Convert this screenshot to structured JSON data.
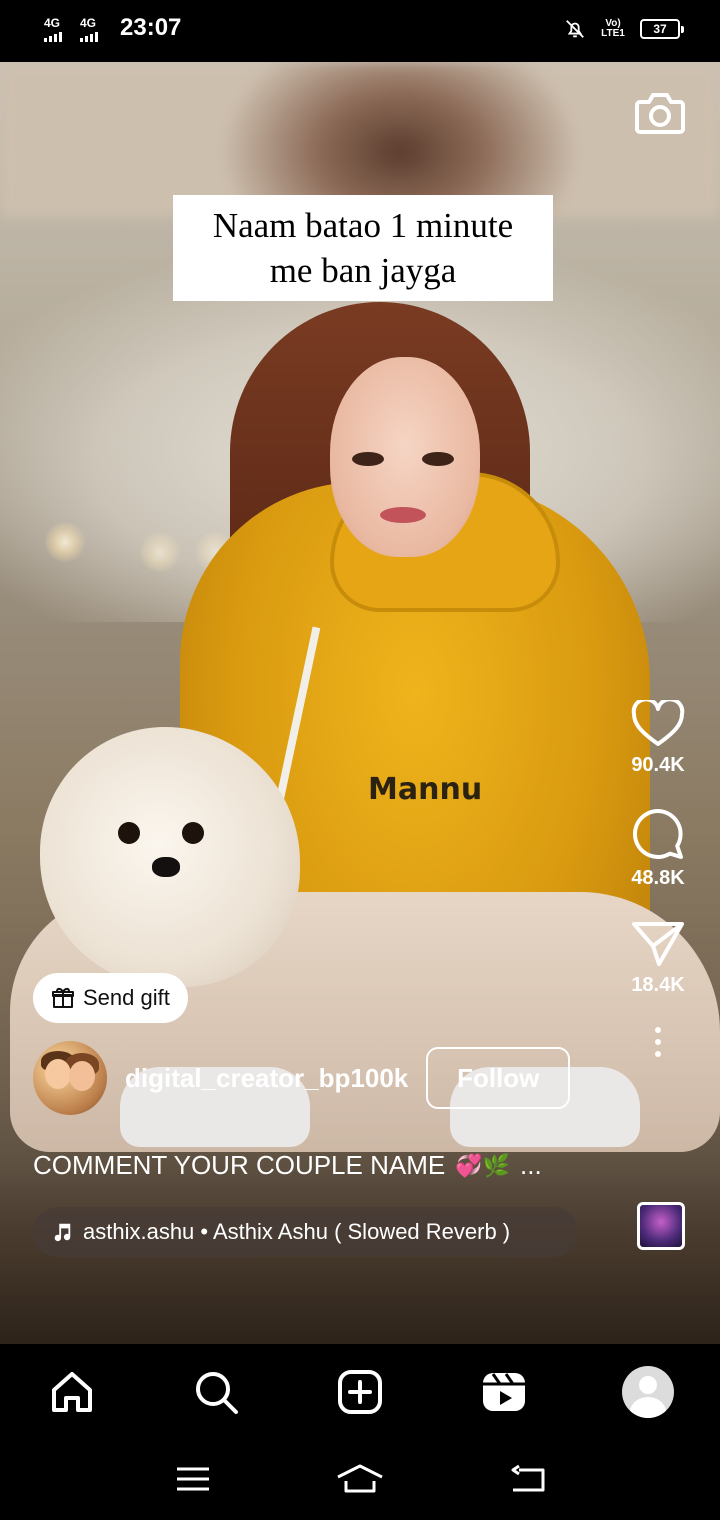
{
  "status_bar": {
    "signal_1_label": "4G",
    "signal_2_label": "4G",
    "time": "23:07",
    "volte_label": "Vo) LTE1",
    "battery_level": "37",
    "icons": [
      "mute-icon",
      "volte-icon",
      "battery-icon"
    ]
  },
  "reel": {
    "caption_line1": "Naam batao 1 minute",
    "caption_line2": "me ban jayga",
    "hoodie_text": "Mannu",
    "camera_icon": "camera-icon"
  },
  "actions": {
    "like_count": "90.4K",
    "comment_count": "48.8K",
    "share_count": "18.4K",
    "icons": [
      "heart-icon",
      "comment-icon",
      "send-icon",
      "more-icon"
    ]
  },
  "gift": {
    "label": "Send gift",
    "icon": "gift-icon"
  },
  "author": {
    "username": "digital_creator_bp100k",
    "follow_label": "Follow"
  },
  "description": {
    "text": "COMMENT YOUR COUPLE NAME",
    "emojis": "💞🌿",
    "more": "..."
  },
  "music": {
    "text": "asthix.ashu • Asthix Ashu ( Slowed Reverb )",
    "icon": "music-note-icon"
  },
  "tabbar": {
    "icons": [
      "home-icon",
      "search-icon",
      "create-icon",
      "reels-icon",
      "profile-avatar"
    ]
  },
  "system_nav": {
    "icons": [
      "menu-icon",
      "home-nav-icon",
      "back-icon"
    ]
  },
  "colors": {
    "hoodie": "#e0a012",
    "background": "#000000",
    "accent": "#ffffff"
  }
}
